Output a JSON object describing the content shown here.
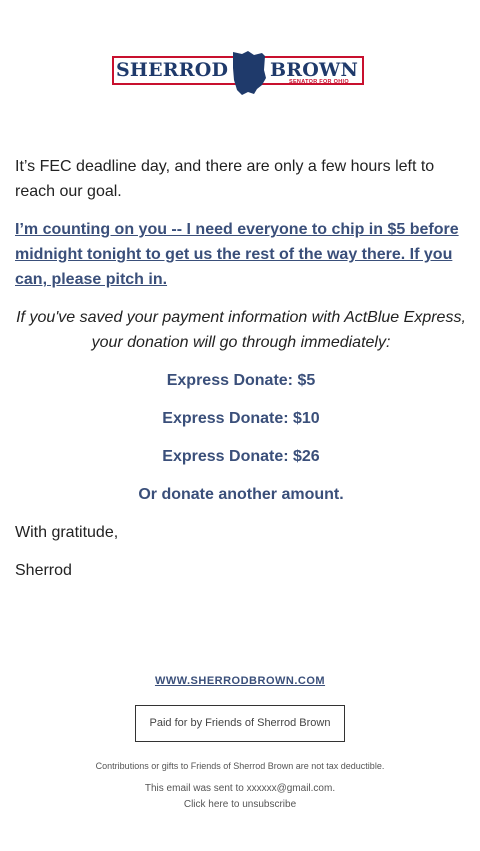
{
  "logo": {
    "left_text": "SHERROD",
    "right_text": "BROWN",
    "subtitle": "SENATOR FOR OHIO",
    "colors": {
      "navy": "#1f3a6b",
      "red": "#c8102e"
    }
  },
  "body": {
    "intro": "It’s FEC deadline day, and there are only a few hours left to reach our goal.",
    "ask": "I’m counting on you -- I need everyone to chip in $5 before midnight tonight to get us the rest of the way there. If you can, please pitch in.",
    "express_note": "If you've saved your payment information with ActBlue Express, your donation will go through immediately:",
    "donate_links": [
      "Express Donate: $5",
      "Express Donate: $10",
      "Express Donate: $26"
    ],
    "other_amount": "Or donate another amount.",
    "closing": "With gratitude,",
    "signature": "Sherrod"
  },
  "footer": {
    "website": "WWW.SHERRODBROWN.COM",
    "paid_for": "Paid for by Friends of Sherrod Brown",
    "tax_note": "Contributions or gifts to Friends of Sherrod Brown are not tax deductible.",
    "sent_to": "This email was sent to xxxxxx@gmail.com.",
    "unsubscribe": "Click here to unsubscribe"
  },
  "colors": {
    "link": "#3a4f7a",
    "text": "#222222"
  }
}
